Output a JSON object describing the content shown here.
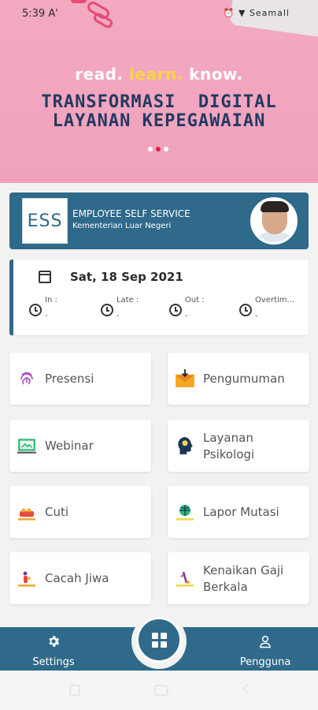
{
  "status_bar": {
    "time": "5:39",
    "time_suffix": "A'",
    "signal_text": "⏰ ▼ Seamall"
  },
  "banner": {
    "tagline_read": "read.",
    "tagline_learn": "learn.",
    "tagline_know": "know.",
    "headline_line1": "TRANSFORMASI  DIGITAL",
    "headline_line2": "LAYANAN KEPEGAWAIAN",
    "slide_count": 3,
    "active_slide": 2
  },
  "ess_card": {
    "logo_text": "ESS",
    "title": "EMPLOYEE SELF SERVICE",
    "subtitle": "Kementerian Luar Negeri"
  },
  "attendance": {
    "date": "Sat, 18 Sep 2021",
    "items": [
      {
        "label": "In :",
        "value": "-"
      },
      {
        "label": "Late :",
        "value": "-"
      },
      {
        "label": "Out :",
        "value": "-"
      },
      {
        "label": "Overtim...",
        "value": "-"
      }
    ]
  },
  "menu": {
    "presensi": "Presensi",
    "pengumuman": "Pengumuman",
    "webinar": "Webinar",
    "layanan_psikologi_1": "Layanan",
    "layanan_psikologi_2": "Psikologi",
    "cuti": "Cuti",
    "lapor_mutasi": "Lapor Mutasi",
    "cacah_jiwa": "Cacah Jiwa",
    "kenaikan_gaji_1": "Kenaikan Gaji",
    "kenaikan_gaji_2": "Berkala"
  },
  "bottom_nav": {
    "settings": "Settings",
    "user": "Pengguna"
  },
  "colors": {
    "primary": "#2f6a8a",
    "banner": "#f3a9c1",
    "headline": "#243a63",
    "accent_yellow": "#f5d54a"
  }
}
